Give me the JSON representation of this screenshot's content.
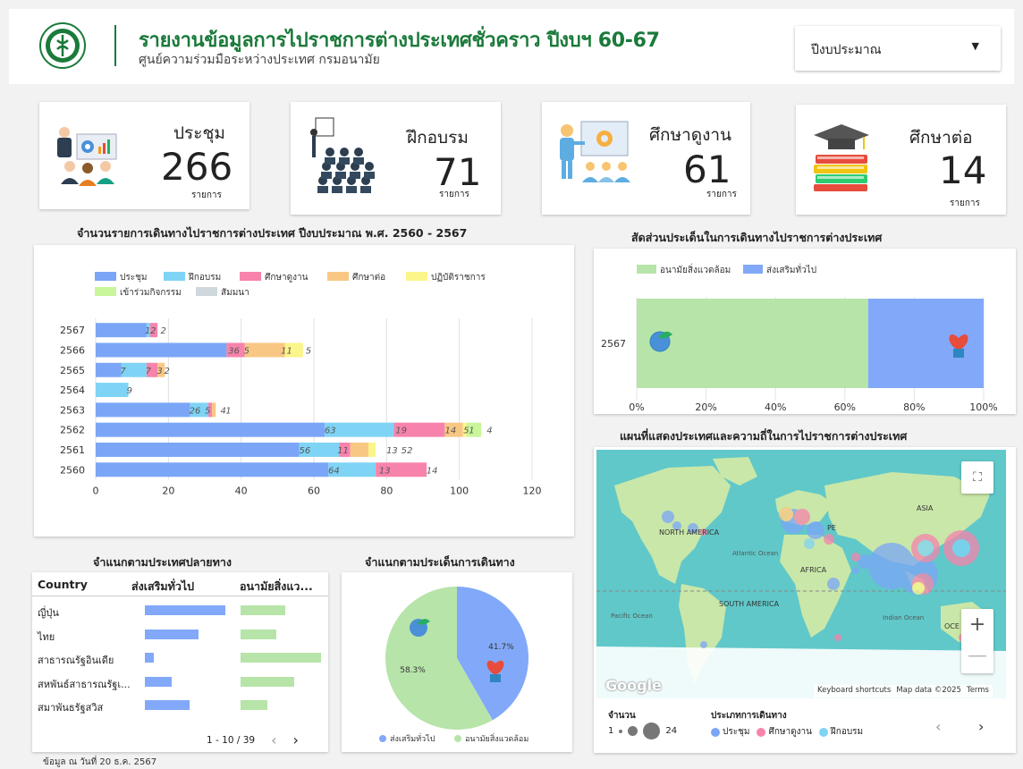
{
  "header": {
    "title": "รายงานข้อมูลการไปราชการต่างประเทศชั่วคราว ปีงบฯ 60-67",
    "subtitle": "ศูนย์ความร่วมมือระหว่างประเทศ กรมอนามัย",
    "dropdown_label": "ปีงบประมาณ"
  },
  "kpis": [
    {
      "label": "ประชุม",
      "value": "266",
      "unit": "รายการ"
    },
    {
      "label": "ฝึกอบรม",
      "value": "71",
      "unit": "รายการ"
    },
    {
      "label": "ศึกษาดูงาน",
      "value": "61",
      "unit": "รายการ"
    },
    {
      "label": "ศึกษาต่อ",
      "value": "14",
      "unit": "รายการ"
    }
  ],
  "sections": {
    "bar_title": "จำนวนรายการเดินทางไปราชการต่างประเทศ ปีงบประมาณ พ.ศ. 2560 - 2567",
    "share_title": "สัดส่วนประเด็นในการเดินทางไปราชการต่างประเทศ",
    "map_title": "แผนที่แสดงประเทศและความถี่ในการไปราชการต่างประเทศ",
    "country_title": "จำแนกตามประเทศปลายทาง",
    "issue_title": "จำแนกตามประเด็นการเดินทาง"
  },
  "chart_data": [
    {
      "type": "bar",
      "orientation": "horizontal",
      "stacked": true,
      "categories": [
        "2567",
        "2566",
        "2565",
        "2564",
        "2563",
        "2562",
        "2561",
        "2560"
      ],
      "xlim": [
        0,
        120
      ],
      "xticks": [
        0,
        20,
        40,
        60,
        80,
        100,
        120
      ],
      "legend_position": "top",
      "series": [
        {
          "name": "ประชุม",
          "color": "#7ba6f7",
          "values": [
            14,
            36,
            7,
            0,
            26,
            63,
            56,
            64
          ]
        },
        {
          "name": "ฝึกอบรม",
          "color": "#7fd4f5",
          "values": [
            1,
            0,
            7,
            9,
            5,
            19,
            11,
            13
          ]
        },
        {
          "name": "ศึกษาดูงาน",
          "color": "#f783ac",
          "values": [
            2,
            5,
            3,
            0,
            1,
            14,
            3,
            14
          ]
        },
        {
          "name": "ศึกษาต่อ",
          "color": "#f9c784",
          "values": [
            0,
            11,
            2,
            0,
            1,
            5,
            5,
            0
          ]
        },
        {
          "name": "ปฏิบัติราชการ",
          "color": "#fbf58a",
          "values": [
            0,
            5,
            0,
            0,
            0,
            1,
            2,
            0
          ]
        },
        {
          "name": "เข้าร่วมกิจกรรม",
          "color": "#c9f59b",
          "values": [
            0,
            0,
            0,
            0,
            0,
            4,
            0,
            0
          ]
        },
        {
          "name": "สัมมนา",
          "color": "#cfd8dc",
          "values": [
            0,
            0,
            0,
            0,
            0,
            0,
            0,
            0
          ]
        }
      ],
      "labels": [
        [
          {
            "t": "1",
            "x": 14.3
          },
          {
            "t": "2",
            "x": 15.8
          },
          {
            "t": "2",
            "x": 18.6
          }
        ],
        [
          {
            "t": "36",
            "x": 38
          },
          {
            "t": "5",
            "x": 41.5
          },
          {
            "t": "11",
            "x": 52.5
          },
          {
            "t": "5",
            "x": 58.5
          }
        ],
        [
          {
            "t": "7",
            "x": 7.5
          },
          {
            "t": "7",
            "x": 14.5
          },
          {
            "t": "3",
            "x": 17.6
          },
          {
            "t": "2",
            "x": 19.6
          }
        ],
        [
          {
            "t": "9",
            "x": 9.3
          }
        ],
        [
          {
            "t": "26",
            "x": 27.3
          },
          {
            "t": "5",
            "x": 30.8
          },
          {
            "t": "4",
            "x": 35.1
          },
          {
            "t": "1",
            "x": 36.5
          }
        ],
        [
          {
            "t": "63",
            "x": 64.5
          },
          {
            "t": "19",
            "x": 84
          },
          {
            "t": "14",
            "x": 97.6
          },
          {
            "t": "5",
            "x": 101.9
          },
          {
            "t": "1",
            "x": 103.4
          },
          {
            "t": "4",
            "x": 108.3
          }
        ],
        [
          {
            "t": "56",
            "x": 57.5
          },
          {
            "t": "11",
            "x": 68
          },
          {
            "t": "13",
            "x": 81.5
          },
          {
            "t": "5",
            "x": 84.8
          },
          {
            "t": "2",
            "x": 86.4
          }
        ],
        [
          {
            "t": "64",
            "x": 65.5
          },
          {
            "t": "13",
            "x": 79.5
          },
          {
            "t": "14",
            "x": 92.5
          }
        ]
      ]
    },
    {
      "type": "bar",
      "orientation": "horizontal",
      "stacked_percent": true,
      "categories": [
        "2567"
      ],
      "xticks": [
        "0%",
        "20%",
        "40%",
        "60%",
        "80%",
        "100%"
      ],
      "series": [
        {
          "name": "อนามัยสิ่งแวดล้อม",
          "color": "#b7e4a9",
          "values": [
            66.7
          ]
        },
        {
          "name": "ส่งเสริมทั่วไป",
          "color": "#82a9f9",
          "values": [
            33.3
          ]
        }
      ]
    },
    {
      "type": "pie",
      "slices": [
        {
          "name": "ส่งเสริมทั่วไป",
          "value": 41.7,
          "label": "41.7%",
          "color": "#82a9f9"
        },
        {
          "name": "อนามัยสิ่งแวดล้อม",
          "value": 58.3,
          "label": "58.3%",
          "color": "#b7e4a9"
        }
      ]
    },
    {
      "type": "table",
      "columns": [
        "Country",
        "ส่งเสริมทั่วไป",
        "อนามัยสิ่งแว..."
      ],
      "rows": [
        {
          "country": "ญี่ปุ่น",
          "general": 9,
          "env": 5
        },
        {
          "country": "ไทย",
          "general": 6,
          "env": 4
        },
        {
          "country": "สาธารณรัฐอินเดีย",
          "general": 1,
          "env": 9
        },
        {
          "country": "สหพันธ์สาธารณรัฐเ...",
          "general": 3,
          "env": 6
        },
        {
          "country": "สมาพันธรัฐสวิส",
          "general": 5,
          "env": 3
        }
      ],
      "max_scale": 10,
      "pagination": "1 - 10 / 39"
    }
  ],
  "map": {
    "labels": [
      "ASIA",
      "NORTH AMERICA",
      "AFRICA",
      "SOUTH AMERICA",
      "Atlantic Ocean",
      "Pacific Ocean",
      "Indian Ocean",
      "OCE",
      "PE"
    ],
    "google": "Google",
    "attrib": [
      "Keyboard shortcuts",
      "Map data ©2025",
      "Terms"
    ],
    "legend_count_title": "จำนวน",
    "legend_count_min": "1",
    "legend_count_max": "24",
    "legend_type_title": "ประเภทการเดินทาง",
    "legend_types": [
      {
        "name": "ประชุม",
        "color": "#7ba6f7"
      },
      {
        "name": "ศึกษาดูงาน",
        "color": "#f783ac"
      },
      {
        "name": "ฝึกอบรม",
        "color": "#7fd4f5"
      }
    ]
  },
  "footer": "ข้อมูล ณ วันที่ 20 ธ.ค. 2567"
}
